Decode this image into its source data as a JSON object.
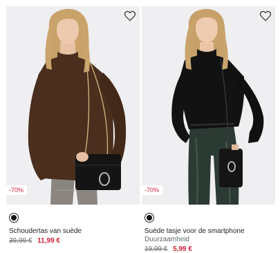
{
  "colors": {
    "sale_red": "#d41f36",
    "photo_bg": "#efeff1"
  },
  "products": [
    {
      "photo_alt": "Model in bruine top met zwarte schoudertas",
      "wishlist_icon": "heart-outline-icon",
      "discount_badge": "-70%",
      "swatch_color": "#111111",
      "name": "Schoudertas van suède",
      "subtitle": "",
      "old_price": "39,99 €",
      "new_price": "11,99 €"
    },
    {
      "photo_alt": "Model in zwarte top met telefoontasje",
      "wishlist_icon": "heart-outline-icon",
      "discount_badge": "-70%",
      "swatch_color": "#111111",
      "name": "Suède tasje voor de smartphone",
      "subtitle": "Duurzaamheid",
      "old_price": "19,99 €",
      "new_price": "5,99 €"
    }
  ]
}
